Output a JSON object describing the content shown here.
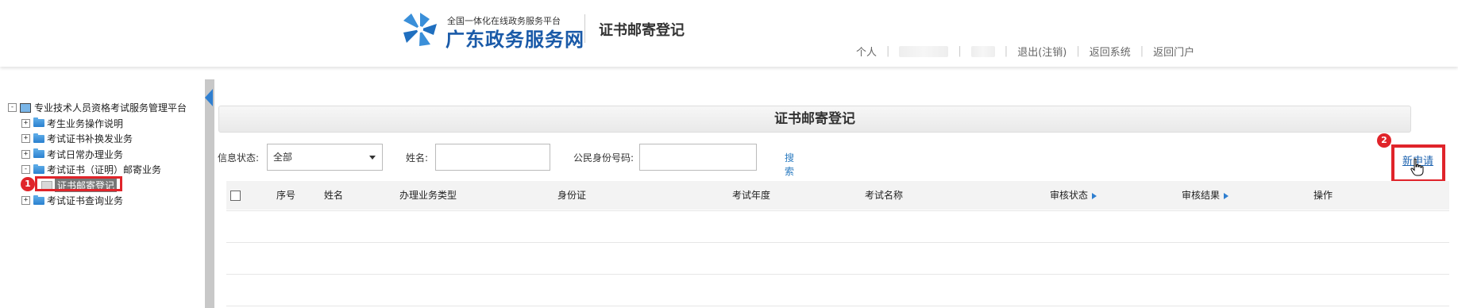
{
  "header": {
    "brand_small": "全国一体化在线政务服务平台",
    "brand_big": "广东政务服务网",
    "page_heading": "证书邮寄登记",
    "nav": {
      "personal": "个人",
      "logout": "退出(注销)",
      "return_system": "返回系统",
      "return_portal": "返回门户"
    }
  },
  "tree": {
    "root": "专业技术人员资格考试服务管理平台",
    "items": [
      {
        "label": "考生业务操作说明",
        "toggle": "+"
      },
      {
        "label": "考试证书补换发业务",
        "toggle": "+"
      },
      {
        "label": "考试日常办理业务",
        "toggle": "+"
      },
      {
        "label": "考试证书（证明）邮寄业务",
        "toggle": "-"
      },
      {
        "label": "证书邮寄登记",
        "selected": true
      },
      {
        "label": "考试证书查询业务",
        "toggle": "+"
      }
    ],
    "root_toggle": "-"
  },
  "annotations": {
    "step1": "1",
    "step2": "2"
  },
  "panel": {
    "title": "证书邮寄登记",
    "filters": {
      "status_label": "信息状态:",
      "status_value": "全部",
      "name_label": "姓名:",
      "name_value": "",
      "id_label": "公民身份号码:",
      "id_value": "",
      "search_label": "搜索"
    },
    "new_label": "新申请",
    "columns": [
      "序号",
      "姓名",
      "办理业务类型",
      "身份证",
      "考试年度",
      "考试名称",
      "审核状态",
      "审核结果",
      "操作"
    ]
  },
  "colors": {
    "accent": "#2f7fd0",
    "annotation": "#e0242a",
    "brand": "#1a5aa8"
  }
}
